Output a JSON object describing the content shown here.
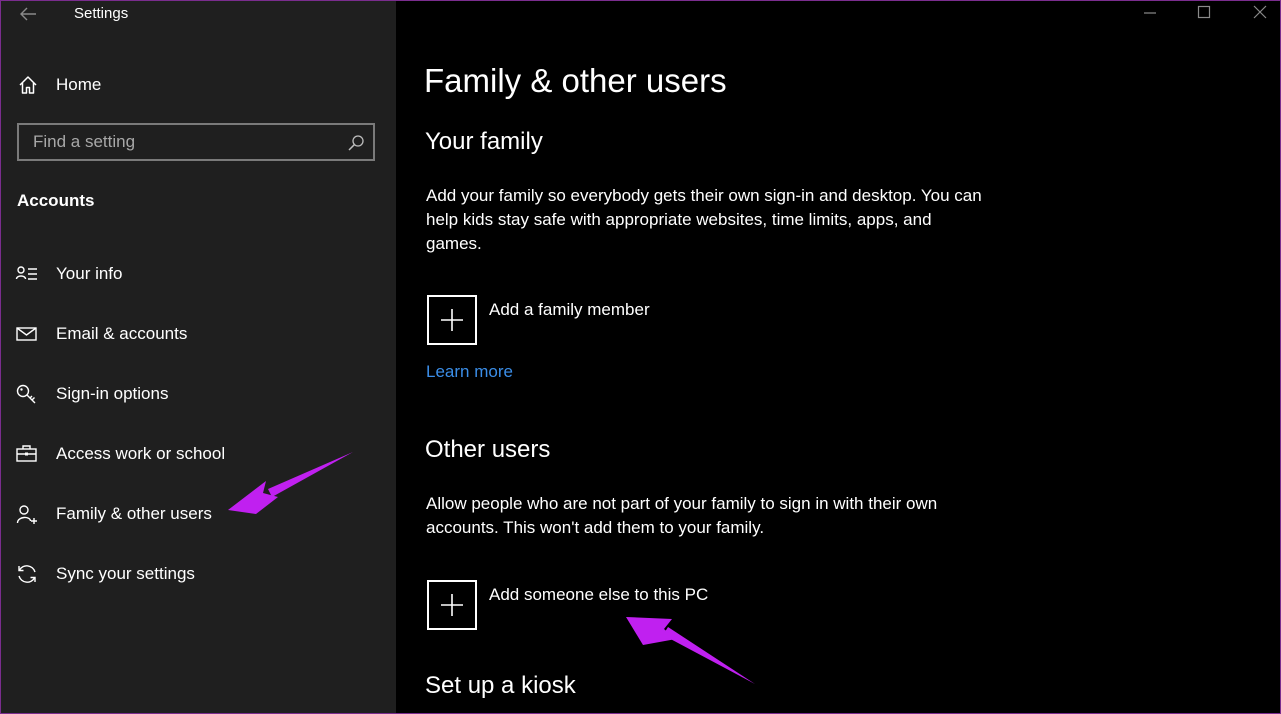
{
  "window": {
    "title": "Settings",
    "back_icon": "back-arrow-icon",
    "controls": [
      "minimize-icon",
      "maximize-icon",
      "close-icon"
    ]
  },
  "sidebar": {
    "home_label": "Home",
    "search_placeholder": "Find a setting",
    "section_title": "Accounts",
    "items": [
      {
        "label": "Your info",
        "icon": "contact-card-icon"
      },
      {
        "label": "Email & accounts",
        "icon": "mail-icon"
      },
      {
        "label": "Sign-in options",
        "icon": "key-icon"
      },
      {
        "label": "Access work or school",
        "icon": "briefcase-icon"
      },
      {
        "label": "Family & other users",
        "icon": "add-person-icon",
        "selected": true
      },
      {
        "label": "Sync your settings",
        "icon": "sync-icon"
      }
    ]
  },
  "main": {
    "page_title": "Family & other users",
    "family": {
      "heading": "Your family",
      "description": "Add your family so everybody gets their own sign-in and desktop. You can help kids stay safe with appropriate websites, time limits, apps, and games.",
      "add_label": "Add a family member",
      "learn_more": "Learn more"
    },
    "other": {
      "heading": "Other users",
      "description": "Allow people who are not part of your family to sign in with their own accounts. This won't add them to your family.",
      "add_label": "Add someone else to this PC"
    },
    "kiosk": {
      "heading": "Set up a kiosk"
    }
  },
  "colors": {
    "sidebar_bg": "#1f1f1f",
    "main_bg": "#000000",
    "link": "#3b8ee8",
    "annotation_arrow": "#c020f0"
  }
}
